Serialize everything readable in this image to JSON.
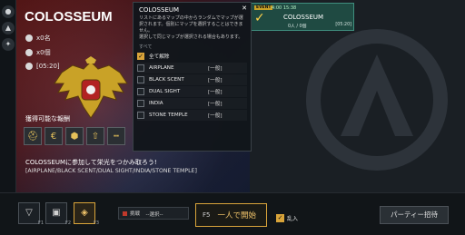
{
  "hero": {
    "title": "COLOSSEUM",
    "players_required": "x0名",
    "items": "x0個",
    "duration": "[05:20]",
    "rewards_label": "獲得可能な報酬",
    "description": "COLOSSEUMに参加して栄光をつかみ取ろう!",
    "map_list": "[AIRPLANE/BLACK SCENT/DUAL SIGHT/INDIA/STONE TEMPLE]"
  },
  "dropdown": {
    "title": "COLOSSEUM",
    "help_text": [
      "リストにあるマップの中からランダムでマップが選",
      "択されます。個別にマップを選択することはできま",
      "せん。",
      "選択して同じマップが選択される場合もあります。"
    ],
    "section_label": "すべて",
    "master_label": "全て解除",
    "maps": [
      {
        "name": "AIRPLANE",
        "mode": "[一般]"
      },
      {
        "name": "BLACK SCENT",
        "mode": "[一般]"
      },
      {
        "name": "DUAL SIGHT",
        "mode": "[一般]"
      },
      {
        "name": "INDIA",
        "mode": "[一般]"
      },
      {
        "name": "STONE TEMPLE",
        "mode": "[一般]"
      }
    ]
  },
  "map_card": {
    "event_badge": "EVENT",
    "time": "4:00 15:38",
    "title": "COLOSSEUM",
    "players": "0人 / 0個",
    "duration": "[05:20]"
  },
  "bottom_bar": {
    "f1_label": "F1",
    "f2_label": "F2",
    "f3_label": "F3",
    "challenge_label": "挑戦",
    "select_label": "--選択--",
    "solo_key": "F5",
    "solo_label": "一人で開始",
    "rannyu_label": "乱入",
    "party_label": "パーティー招待"
  },
  "colors": {
    "accent": "#d9a43a",
    "card_bg": "#1f4a42",
    "card_border": "#3f8e7e"
  },
  "icons": {
    "rail": [
      "globe-icon",
      "shield-icon",
      "wing-icon"
    ],
    "players": "person-icon",
    "items": "bag-icon",
    "time": "clock-icon",
    "rewards": [
      "helmet-icon",
      "coin-icon",
      "badge-icon",
      "arrow-up-icon",
      "rifle-icon"
    ]
  }
}
